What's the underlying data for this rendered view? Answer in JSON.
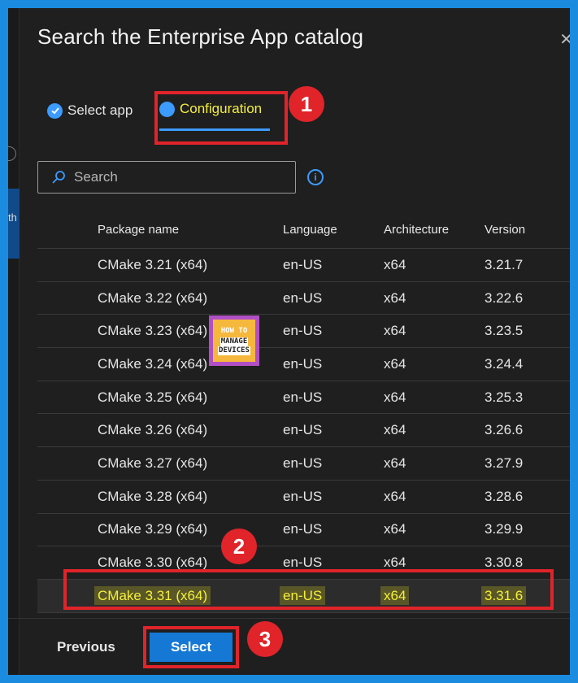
{
  "dialog": {
    "title": "Search the Enterprise App catalog"
  },
  "tabs": [
    {
      "label": "Select app",
      "state": "completed"
    },
    {
      "label": "Configuration",
      "state": "active"
    }
  ],
  "search": {
    "placeholder": "Search"
  },
  "left_strip": {
    "label": "th"
  },
  "table": {
    "headers": [
      "Package name",
      "Language",
      "Architecture",
      "Version"
    ],
    "rows": [
      {
        "name": "CMake 3.21 (x64)",
        "language": "en-US",
        "arch": "x64",
        "version": "3.21.7"
      },
      {
        "name": "CMake 3.22 (x64)",
        "language": "en-US",
        "arch": "x64",
        "version": "3.22.6"
      },
      {
        "name": "CMake 3.23 (x64)",
        "language": "en-US",
        "arch": "x64",
        "version": "3.23.5"
      },
      {
        "name": "CMake 3.24 (x64)",
        "language": "en-US",
        "arch": "x64",
        "version": "3.24.4"
      },
      {
        "name": "CMake 3.25 (x64)",
        "language": "en-US",
        "arch": "x64",
        "version": "3.25.3"
      },
      {
        "name": "CMake 3.26 (x64)",
        "language": "en-US",
        "arch": "x64",
        "version": "3.26.6"
      },
      {
        "name": "CMake 3.27 (x64)",
        "language": "en-US",
        "arch": "x64",
        "version": "3.27.9"
      },
      {
        "name": "CMake 3.28 (x64)",
        "language": "en-US",
        "arch": "x64",
        "version": "3.28.6"
      },
      {
        "name": "CMake 3.29 (x64)",
        "language": "en-US",
        "arch": "x64",
        "version": "3.29.9"
      },
      {
        "name": "CMake 3.30 (x64)",
        "language": "en-US",
        "arch": "x64",
        "version": "3.30.8"
      },
      {
        "name": "CMake 3.31 (x64)",
        "language": "en-US",
        "arch": "x64",
        "version": "3.31.6",
        "selected": true
      }
    ]
  },
  "footer": {
    "previous_label": "Previous",
    "select_label": "Select"
  },
  "annotations": {
    "badge1": "1",
    "badge2": "2",
    "badge3": "3"
  },
  "logo": {
    "line1": "HOW TO",
    "line2": "MANAGE",
    "line3": "DEVICES"
  },
  "colors": {
    "accent": "#3c9bff",
    "highlight": "#f5ef3a",
    "callout": "#e0242a",
    "primary_button": "#1478d4"
  }
}
